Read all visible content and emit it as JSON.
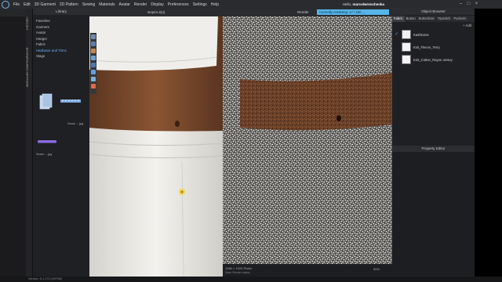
{
  "menu": {
    "items": [
      "File",
      "Edit",
      "3D Garment",
      "2D Pattern",
      "Sewing",
      "Materials",
      "Avatar",
      "Render",
      "Display",
      "Preferences",
      "Settings",
      "Help"
    ],
    "greeting": "Hello,",
    "username": "marcelwrenchenka"
  },
  "toolbar": {
    "simulation_label": "SIMULATION"
  },
  "vertical_tabs": [
    "HISTORY",
    "MODULAR CONFIGURATOR"
  ],
  "library": {
    "title": "Library",
    "items": [
      "Favorites",
      "Garment",
      "Avatar",
      "Hanger",
      "Fabric",
      "Hardware and Trims",
      "Stage"
    ],
    "active_index": 5,
    "thumbs": [
      "Seam ....jpg",
      "Seam ....jpg"
    ]
  },
  "viewport3d": {
    "title": "wopen.Zprj"
  },
  "render": {
    "title": "Render",
    "status": "Currently rendering: 17 / 100 ...",
    "pixels": "1080 × 1920 Pixels",
    "footer_label": "Save    Render status",
    "zoom": "50%"
  },
  "object_browser": {
    "title": "Object Browser",
    "tabs": [
      "Fabric",
      "Button",
      "Buttonhole",
      "Topstitch",
      "Puckerin"
    ],
    "add_label": "+ Add",
    "fabrics": [
      "Kashkorse",
      "Knit_Fleece_Terry",
      "Knit_Cotton_Rayon Jersey"
    ],
    "selected_index": 0
  },
  "property_editor": {
    "title": "Property Editor"
  },
  "statusbar": {
    "version": "Version: 6.1.172 (r19758)"
  },
  "colors": {
    "accent": "#56b5e8",
    "skin": "#7a4a2c",
    "cloth": "#e9e7e2"
  }
}
